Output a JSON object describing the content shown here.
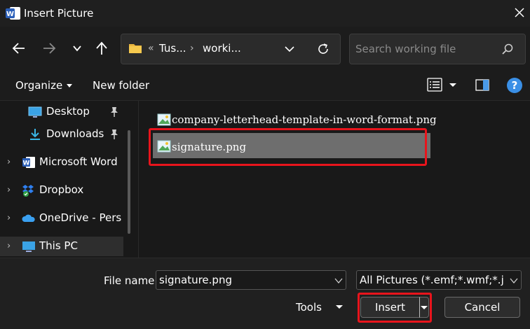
{
  "window": {
    "title": "Insert Picture"
  },
  "navigation": {
    "back_icon": "arrow-left-icon",
    "forward_icon": "arrow-right-icon",
    "recent_icon": "chevron-down-icon",
    "up_icon": "arrow-up-icon"
  },
  "address_bar": {
    "overflow": "«",
    "crumbs": [
      "Tus...",
      "worki..."
    ],
    "separator": "›"
  },
  "search": {
    "placeholder": "Search working file"
  },
  "commands": {
    "organize": "Organize",
    "new_folder": "New folder",
    "help": "?"
  },
  "sidebar": {
    "items": [
      {
        "label": "Desktop",
        "icon": "desktop-icon",
        "pinned": true
      },
      {
        "label": "Downloads",
        "icon": "download-icon",
        "pinned": true
      },
      {
        "label": "Microsoft Word",
        "icon": "word-icon"
      },
      {
        "label": "Dropbox",
        "icon": "dropbox-icon"
      },
      {
        "label": "OneDrive - Perso",
        "icon": "onedrive-icon"
      },
      {
        "label": "This PC",
        "icon": "pc-icon",
        "selected": true
      }
    ]
  },
  "files": [
    {
      "name": "company-letterhead-template-in-word-format.png",
      "icon": "image-file-icon",
      "selected": false
    },
    {
      "name": "signature.png",
      "icon": "image-file-icon",
      "selected": true
    }
  ],
  "footer": {
    "file_name_label": "File name:",
    "file_name_value": "signature.png",
    "file_type": "All Pictures (*.emf;*.wmf;*.jpg;*.j",
    "tools": "Tools",
    "insert": "Insert",
    "cancel": "Cancel"
  },
  "colors": {
    "highlight": "#e8141c",
    "accent": "#3a8fe6",
    "selected_row": "#6e6e6e"
  }
}
